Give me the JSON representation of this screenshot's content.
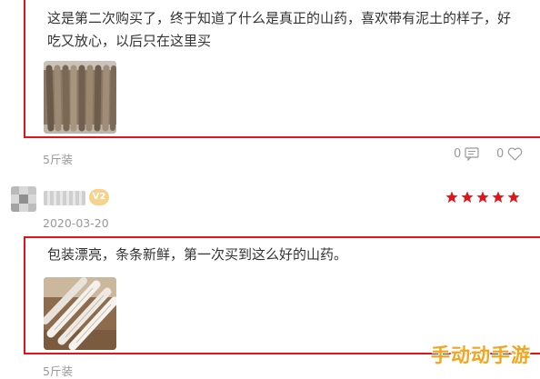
{
  "reviews": [
    {
      "text": "这是第二次购买了，终于知道了什么是真正的山药，喜欢带有泥土的样子，好吃又放心，以后只在这里买",
      "spec": "5斤装",
      "comment_count": "0",
      "like_count": "0",
      "photo_icon": "yam-photo"
    },
    {
      "username": "用户",
      "badge": "V2",
      "rating": 5,
      "date": "2020-03-20",
      "text": "包装漂亮，条条新鲜，第一次买到这么好的山药。",
      "spec": "5斤装",
      "photo_icon": "packaged-yam-photo"
    }
  ],
  "colors": {
    "highlight_border": "#e0151b",
    "star": "#e0151b",
    "watermark": "#f2a51e"
  },
  "watermark": "手动动手游"
}
